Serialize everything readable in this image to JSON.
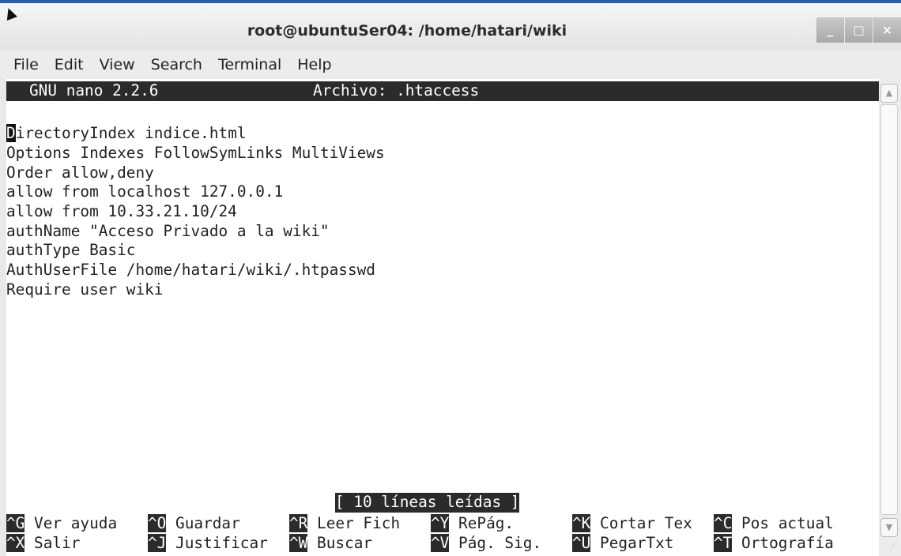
{
  "window": {
    "title": "root@ubuntuSer04: /home/hatari/wiki",
    "minimize_label": "_",
    "maximize_label": "□",
    "close_label": "×"
  },
  "menu": [
    "File",
    "Edit",
    "View",
    "Search",
    "Terminal",
    "Help"
  ],
  "nano": {
    "version": "GNU nano 2.2.6",
    "file_label": "Archivo: .htaccess",
    "cursor_char": "D",
    "lines": [
      "irectoryIndex indice.html",
      "Options Indexes FollowSymLinks MultiViews",
      "Order allow,deny",
      "allow from localhost 127.0.0.1",
      "allow from 10.33.21.10/24",
      "authName \"Acceso Privado a la wiki\"",
      "authType Basic",
      "AuthUserFile /home/hatari/wiki/.htpasswd",
      "Require user wiki"
    ],
    "status": "[ 10 líneas leídas ]",
    "shortcuts_row1": [
      {
        "key": "^G",
        "label": "Ver ayuda"
      },
      {
        "key": "^O",
        "label": "Guardar"
      },
      {
        "key": "^R",
        "label": "Leer Fich"
      },
      {
        "key": "^Y",
        "label": "RePág."
      },
      {
        "key": "^K",
        "label": "Cortar Tex"
      },
      {
        "key": "^C",
        "label": "Pos actual"
      }
    ],
    "shortcuts_row2": [
      {
        "key": "^X",
        "label": "Salir"
      },
      {
        "key": "^J",
        "label": "Justificar"
      },
      {
        "key": "^W",
        "label": "Buscar"
      },
      {
        "key": "^V",
        "label": "Pág. Sig."
      },
      {
        "key": "^U",
        "label": "PegarTxt"
      },
      {
        "key": "^T",
        "label": "Ortografía"
      }
    ]
  }
}
